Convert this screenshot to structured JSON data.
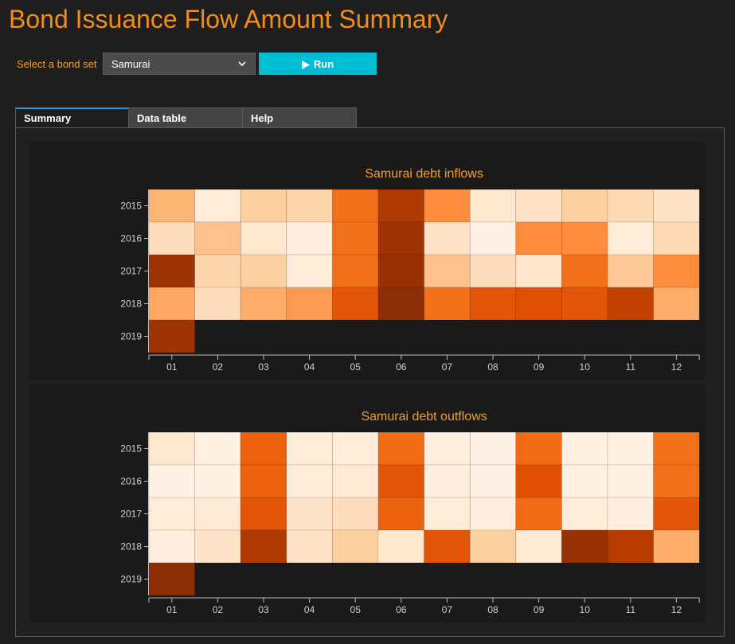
{
  "app": {
    "title": "Bond Issuance Flow Amount Summary"
  },
  "controls": {
    "select_label": "Select a bond set",
    "bond_set_selected": "Samurai",
    "run_label": "Run"
  },
  "tabs": [
    {
      "label": "Summary",
      "active": true
    },
    {
      "label": "Data table",
      "active": false
    },
    {
      "label": "Help",
      "active": false
    }
  ],
  "colors": {
    "title": "#f28c1a",
    "chart_title": "#f0a030",
    "run_button": "#00bcd4",
    "active_tab_border": "#2f8fd6",
    "heat_low": "#fff5eb",
    "heat_high": "#7f2704"
  },
  "icons": {
    "select": "chevron-down-icon",
    "run": "play-icon"
  },
  "chart_data": [
    {
      "type": "heatmap",
      "title": "Samurai debt inflows",
      "x_categories": [
        "01",
        "02",
        "03",
        "04",
        "05",
        "06",
        "07",
        "08",
        "09",
        "10",
        "11",
        "12"
      ],
      "y_categories": [
        "2015",
        "2016",
        "2017",
        "2018",
        "2019"
      ],
      "color_scale": "oranges",
      "values": [
        [
          0.35,
          0.08,
          0.25,
          0.22,
          0.6,
          0.85,
          0.5,
          0.12,
          0.15,
          0.25,
          0.2,
          0.15
        ],
        [
          0.18,
          0.3,
          0.12,
          0.06,
          0.6,
          0.9,
          0.15,
          0.03,
          0.5,
          0.5,
          0.08,
          0.2
        ],
        [
          0.9,
          0.22,
          0.25,
          0.08,
          0.6,
          0.92,
          0.3,
          0.18,
          0.13,
          0.6,
          0.28,
          0.5
        ],
        [
          0.4,
          0.18,
          0.38,
          0.45,
          0.7,
          0.95,
          0.6,
          0.7,
          0.72,
          0.7,
          0.8,
          0.38
        ],
        [
          0.9,
          null,
          null,
          null,
          null,
          null,
          null,
          null,
          null,
          null,
          null,
          null
        ]
      ]
    },
    {
      "type": "heatmap",
      "title": "Samurai debt outflows",
      "x_categories": [
        "01",
        "02",
        "03",
        "04",
        "05",
        "06",
        "07",
        "08",
        "09",
        "10",
        "11",
        "12"
      ],
      "y_categories": [
        "2015",
        "2016",
        "2017",
        "2018",
        "2019"
      ],
      "color_scale": "oranges",
      "values": [
        [
          0.12,
          0.04,
          0.65,
          0.08,
          0.07,
          0.62,
          0.05,
          0.03,
          0.62,
          0.04,
          0.04,
          0.6
        ],
        [
          0.03,
          0.04,
          0.65,
          0.08,
          0.1,
          0.7,
          0.06,
          0.03,
          0.72,
          0.04,
          0.04,
          0.6
        ],
        [
          0.08,
          0.1,
          0.7,
          0.14,
          0.18,
          0.65,
          0.08,
          0.06,
          0.62,
          0.08,
          0.06,
          0.7
        ],
        [
          0.06,
          0.14,
          0.85,
          0.15,
          0.25,
          0.12,
          0.7,
          0.25,
          0.1,
          0.92,
          0.83,
          0.38
        ],
        [
          0.95,
          null,
          null,
          null,
          null,
          null,
          null,
          null,
          null,
          null,
          null,
          null
        ]
      ]
    }
  ]
}
